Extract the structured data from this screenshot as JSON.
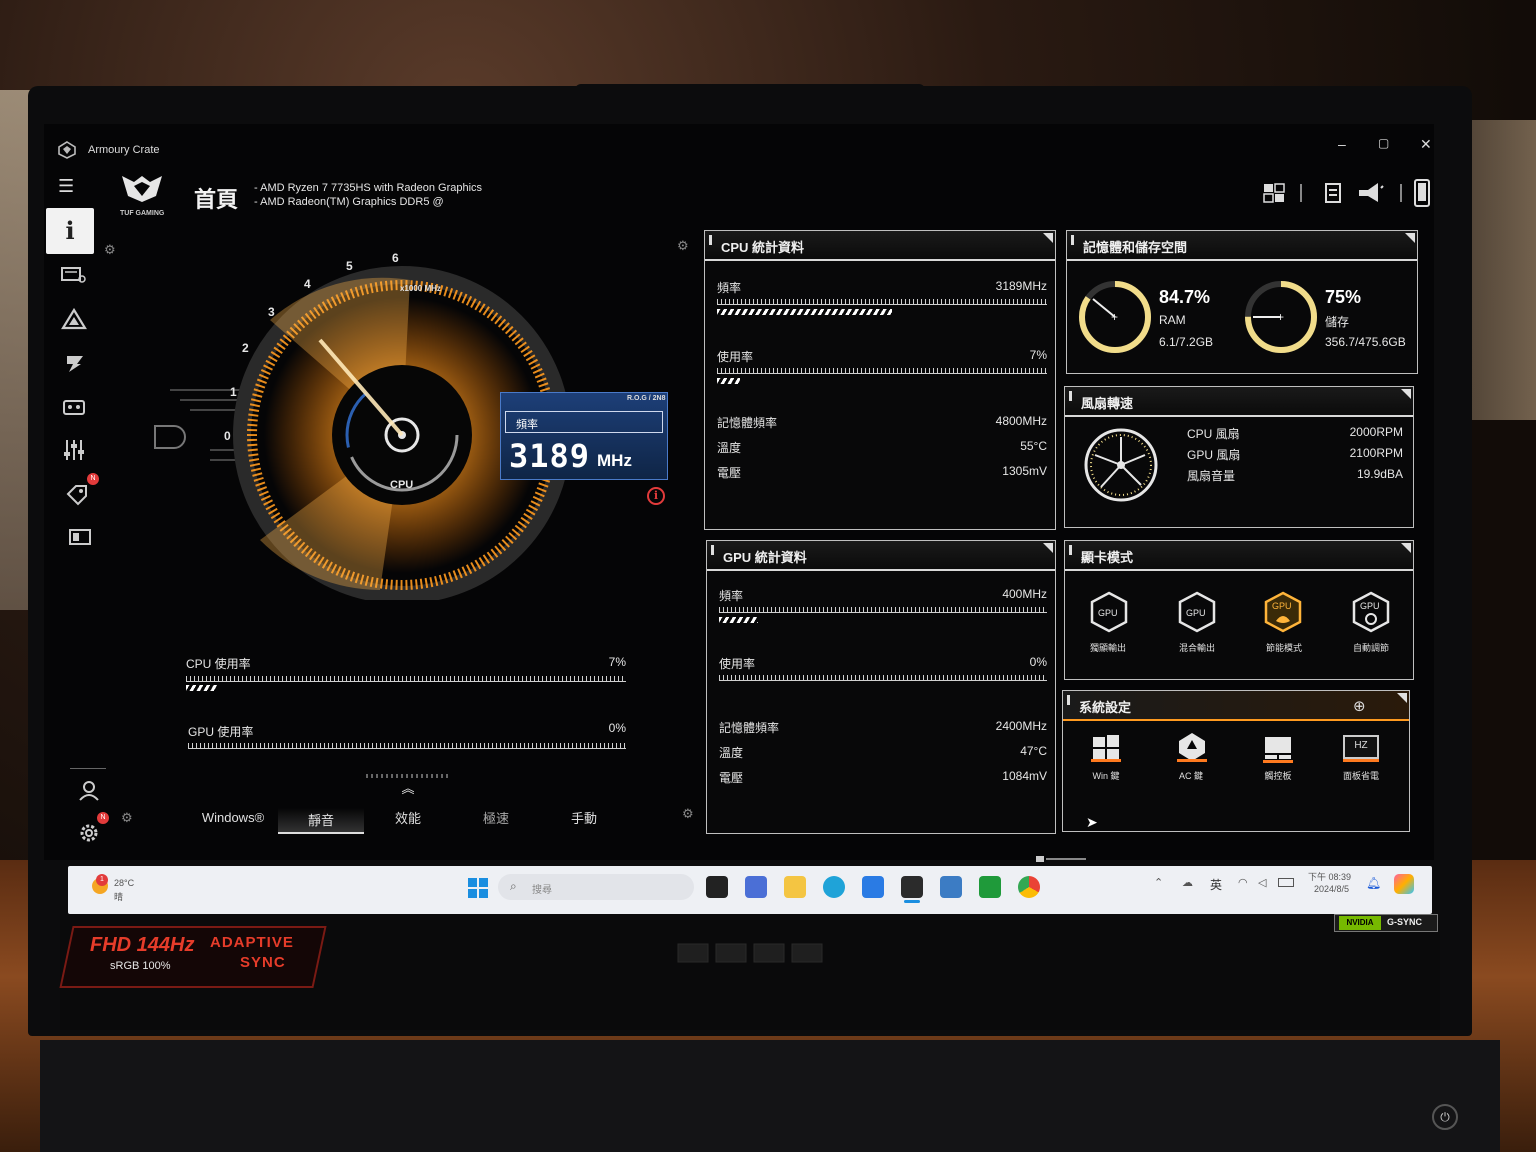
{
  "app": {
    "title": "Armoury Crate",
    "page_title": "首頁",
    "brand": "TUF GAMING",
    "cpu_name": "- AMD Ryzen 7 7735HS with Radeon Graphics",
    "gpu_name": "- AMD Radeon(TM) Graphics DDR5 @"
  },
  "window_controls": {
    "minimize": "–",
    "restore": "▢",
    "close": "✕"
  },
  "gauge": {
    "scale_unit": "x1000 MHz",
    "ticks": [
      "0",
      "1",
      "2",
      "3",
      "4",
      "5",
      "6"
    ],
    "center_label": "CPU",
    "readout_label": "頻率",
    "readout_value": "3189",
    "readout_unit": "MHz",
    "rog_tag": "R.O.G / 2N8",
    "info_glyph": "i"
  },
  "usage": {
    "cpu_label": "CPU 使用率",
    "cpu_value": "7%",
    "cpu_fraction": 0.07,
    "gpu_label": "GPU 使用率",
    "gpu_value": "0%",
    "gpu_fraction": 0.0
  },
  "modes": {
    "items": [
      "Windows®",
      "靜音",
      "效能",
      "極速",
      "手動"
    ],
    "active": "靜音"
  },
  "cpu_stats": {
    "title": "CPU 統計資料",
    "freq_label": "頻率",
    "freq_value": "3189MHz",
    "freq_fraction": 0.53,
    "usage_label": "使用率",
    "usage_value": "7%",
    "usage_fraction": 0.07,
    "mem_label": "記憶體頻率",
    "mem_value": "4800MHz",
    "temp_label": "溫度",
    "temp_value": "55°C",
    "volt_label": "電壓",
    "volt_value": "1305mV"
  },
  "gpu_stats": {
    "title": "GPU 統計資料",
    "freq_label": "頻率",
    "freq_value": "400MHz",
    "freq_fraction": 0.12,
    "usage_label": "使用率",
    "usage_value": "0%",
    "usage_fraction": 0.0,
    "mem_label": "記憶體頻率",
    "mem_value": "2400MHz",
    "temp_label": "溫度",
    "temp_value": "47°C",
    "volt_label": "電壓",
    "volt_value": "1084mV"
  },
  "memory": {
    "title": "記憶體和儲存空間",
    "ram_pct": "84.7%",
    "ram_label": "RAM",
    "ram_detail": "6.1/7.2GB",
    "ram_fraction": 0.847,
    "storage_pct": "75%",
    "storage_label": "儲存",
    "storage_detail": "356.7/475.6GB",
    "storage_fraction": 0.75
  },
  "fan": {
    "title": "風扇轉速",
    "rows": [
      {
        "label": "CPU 風扇",
        "value": "2000RPM"
      },
      {
        "label": "GPU 風扇",
        "value": "2100RPM"
      },
      {
        "label": "風扇音量",
        "value": "19.9dBA"
      }
    ]
  },
  "gpu_mode": {
    "title": "顯卡模式",
    "icon_text": "GPU",
    "items": [
      "獨顯輸出",
      "混合輸出",
      "節能模式",
      "自動調節"
    ]
  },
  "system": {
    "title": "系統設定",
    "items": [
      "Win 鍵",
      "AC 鍵",
      "觸控板",
      "面板省電"
    ],
    "hz_text": "HZ"
  },
  "taskbar": {
    "weather_temp": "28°C",
    "weather_text": "晴",
    "weather_badge": "1",
    "search_placeholder": "搜尋",
    "ime": "英",
    "time": "下午 08:39",
    "date": "2024/8/5"
  },
  "bezel": {
    "panel_spec": "FHD 144Hz",
    "srgb": "sRGB 100%",
    "adaptive_1": "ADAPTIVE",
    "adaptive_2": "SYNC",
    "nvidia": "NVIDIA",
    "gsync": "G-SYNC"
  },
  "colors": {
    "accent": "#ff9a1f",
    "gauge_blue": "#2b5fb0",
    "alert": "#e23b3b"
  }
}
